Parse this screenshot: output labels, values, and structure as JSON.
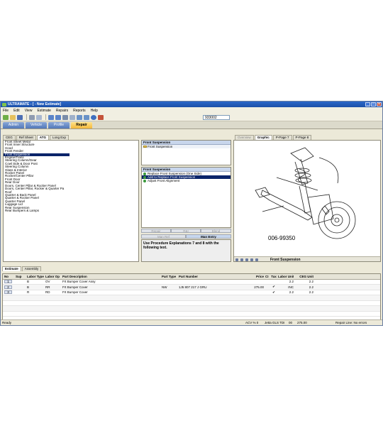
{
  "window": {
    "title": "ULTRAMATE - [ - New Estimate]",
    "controls": [
      "_",
      "□",
      "×"
    ]
  },
  "menu": [
    "File",
    "Edit",
    "View",
    "Estimate",
    "Repairs",
    "Reports",
    "Help"
  ],
  "toolbar": {
    "estimate_number": "933002",
    "icons": [
      "app-icon",
      "open-icon",
      "save-icon",
      "print-icon",
      "preview-icon",
      "grid-icon",
      "list-icon",
      "calc-icon",
      "search-icon",
      "photo-icon",
      "image-icon",
      "help-icon",
      "tools-icon"
    ]
  },
  "nav_tabs": [
    {
      "label": "Admin",
      "active": false
    },
    {
      "label": "Vehicle",
      "active": false
    },
    {
      "label": "Profile",
      "active": false
    },
    {
      "label": "Repair",
      "active": true
    }
  ],
  "left_tabs": [
    {
      "label": "CEG",
      "active": false
    },
    {
      "label": "Ref Sheet",
      "active": false
    },
    {
      "label": "ATG",
      "active": true
    },
    {
      "label": "Long Exp",
      "active": false
    }
  ],
  "right_tabs": [
    {
      "label": "Overview",
      "active": false,
      "dim": true
    },
    {
      "label": "Graphic",
      "active": true,
      "dim": false
    },
    {
      "label": "P-Page 7",
      "active": false,
      "dim": false
    },
    {
      "label": "P-Page 8",
      "active": false,
      "dim": false
    }
  ],
  "sections": [
    "Front Sheet Metal",
    "Front Inner Structure",
    "Hood",
    "Front Fender",
    "Front Suspension",
    "Engine/Trans",
    "Steering Column/Gear",
    "Cowl Side & Door Post",
    "Steering Column",
    "Glass & Interior",
    "Rocker Panel",
    "Rocker/Center Pillar",
    "Front Door",
    "Rear Door",
    "Doors, Center Pillar & Rocker Panel",
    "Doors, Center Pillar, Rocker & Quarter Pa",
    "Roof",
    "Quarter & Back Panel",
    "Quarter & Rocker Panel",
    "Quarter Panel",
    "Luggage Lid",
    "Rear Suspension",
    "Rear Bumpers & Lamps"
  ],
  "selected_section": 4,
  "tree_panel": {
    "header": "Front Suspension",
    "item": "Front Suspension"
  },
  "operations_panel": {
    "header": "Front Suspension",
    "options": [
      {
        "label": "Replace Front Suspension (One Side)",
        "selected": false
      },
      {
        "label": "Add to Replace Front Suspension",
        "selected": true
      },
      {
        "label": "Adjust Front Alignment",
        "selected": false
      }
    ]
  },
  "action_buttons_1": [
    {
      "label": "Repair",
      "enabled": false
    },
    {
      "label": "R&I",
      "enabled": false
    },
    {
      "label": "Blend",
      "enabled": false
    }
  ],
  "action_buttons_2": [
    {
      "label": "Man Ref",
      "enabled": false
    },
    {
      "label": "Man Entry",
      "enabled": true
    }
  ],
  "note": "Use Procedure Explanations 7 and 8 with the following text.",
  "graphic": {
    "code": "006-99350",
    "caption": "Front Suspension"
  },
  "bottom_tabs": [
    {
      "label": "Estimate",
      "active": true
    },
    {
      "label": "Assembly",
      "active": false
    }
  ],
  "estimate_table": {
    "columns": [
      "No",
      "Sup",
      "Labor Type",
      "Labor Op",
      "Part Description",
      "Part Type",
      "Part Number",
      "Price",
      "CI",
      "Tax",
      "Labor Unit",
      "CEG Unit"
    ],
    "rows": [
      [
        "1",
        "",
        "B",
        "OV",
        "Frt Bumper Cover Assy",
        "",
        "",
        "",
        "",
        "",
        "2.2",
        "2.2"
      ],
      [
        "2",
        "",
        "B",
        "RR",
        "Frt Bumper Cover",
        "NW",
        "1J5 807 217 J  GRU",
        "275.00",
        "",
        "✔",
        "INC",
        "2.2"
      ],
      [
        "3",
        "",
        "R",
        "RD",
        "Frt Bumper Cover",
        "",
        "",
        "",
        "",
        "✔",
        "2.2",
        "2.2"
      ]
    ]
  },
  "status_bar": {
    "left": "Ready",
    "version": "ACV % 0",
    "vehicle": "Jetta GLS TDI",
    "f1": "00",
    "f2": "275.00",
    "right": "Repair Line: No errors"
  },
  "colors": {
    "titlebar": "#1b4fa8",
    "selection": "#0a246a",
    "active_tab": "#f3b73a",
    "nav_tab": "#5278b8"
  }
}
